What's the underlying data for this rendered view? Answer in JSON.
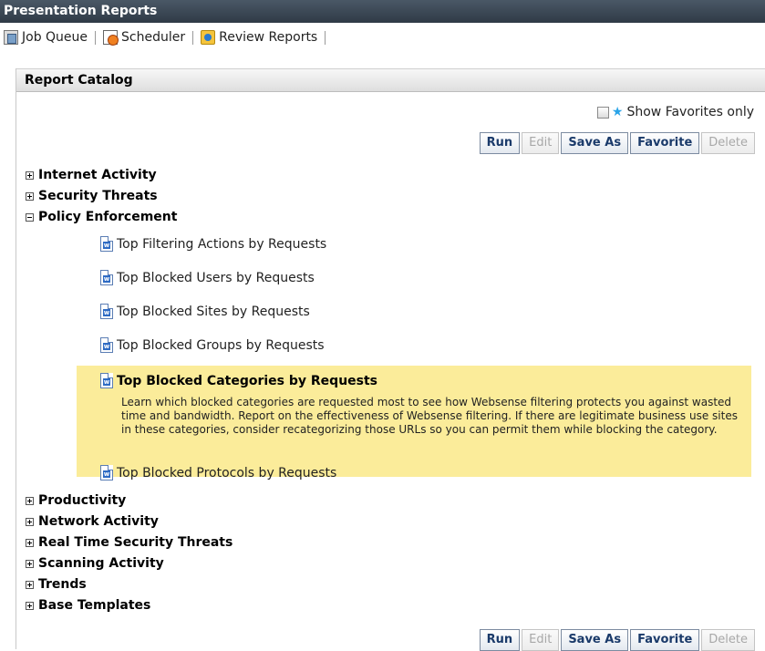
{
  "window": {
    "title": "Presentation Reports"
  },
  "toolbar": {
    "items": [
      {
        "label": "Job Queue",
        "icon": "job-queue-icon"
      },
      {
        "label": "Scheduler",
        "icon": "scheduler-icon"
      },
      {
        "label": "Review Reports",
        "icon": "review-reports-icon"
      }
    ]
  },
  "catalog": {
    "title": "Report Catalog",
    "show_favorites_label": "Show Favorites only",
    "show_favorites_checked": false,
    "buttons": {
      "run": "Run",
      "edit": "Edit",
      "save_as": "Save As",
      "favorite": "Favorite",
      "delete": "Delete"
    },
    "categories_top": [
      "Internet Activity",
      "Security Threats",
      "Policy Enforcement"
    ],
    "expanded_category": "Policy Enforcement",
    "reports": [
      "Top Filtering Actions by Requests",
      "Top Blocked Users by Requests",
      "Top Blocked Sites by Requests",
      "Top Blocked Groups by Requests",
      "Top Blocked Categories by Requests",
      "Top Blocked Protocols by Requests"
    ],
    "selected_report": {
      "title": "Top Blocked Categories by Requests",
      "description": "Learn which blocked categories are requested most to see how Websense filtering protects you against wasted time and bandwidth. Report on the effectiveness of Websense filtering. If there are legitimate business use sites in these categories, consider recategorizing those URLs so you can permit them while blocking the category."
    },
    "categories_bottom": [
      "Productivity",
      "Network Activity",
      "Real Time Security Threats",
      "Scanning Activity",
      "Trends",
      "Base Templates"
    ]
  },
  "colors": {
    "title_bar": "#3a4653",
    "highlight": "#fbec9a",
    "button_text": "#1a3a6a",
    "star": "#2aa4e8"
  }
}
